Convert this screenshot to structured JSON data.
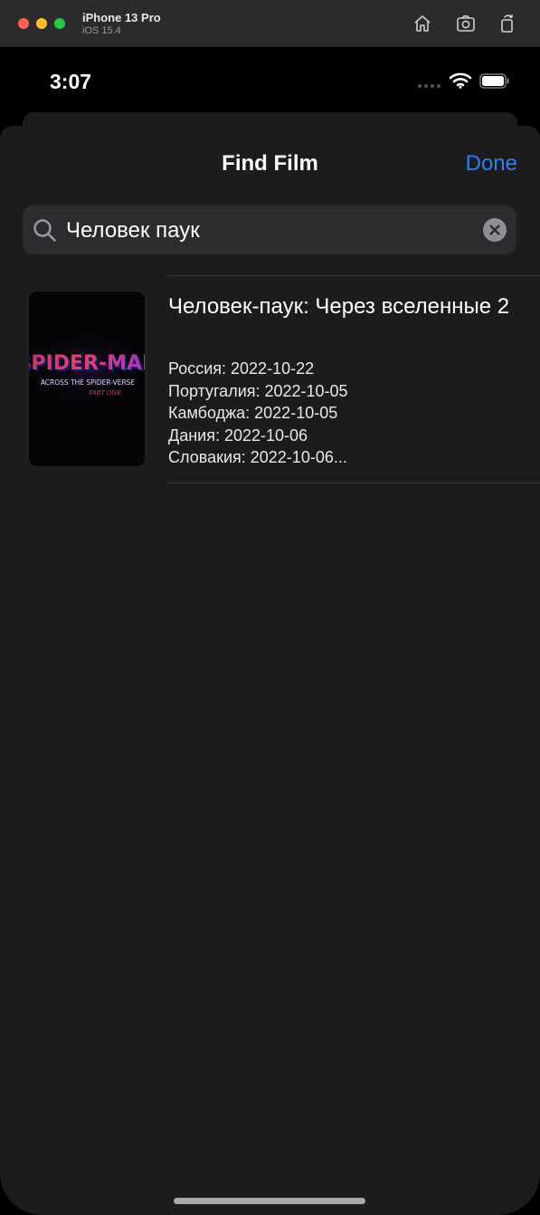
{
  "simulator": {
    "device_name": "iPhone 13 Pro",
    "os_version": "iOS 15.4",
    "toolbar_icons": [
      "home-icon",
      "screenshot-icon",
      "rotate-icon"
    ]
  },
  "status_bar": {
    "time": "3:07"
  },
  "sheet": {
    "title": "Find Film",
    "done_label": "Done",
    "accent_color": "#2f80ed"
  },
  "search": {
    "value": "Человек паук"
  },
  "results": [
    {
      "title": "Человек-паук: Через вселенные 2",
      "poster_text": "SPIDER-MAN",
      "poster_subtitle": "ACROSS THE SPIDER-VERSE",
      "poster_part": "PART ONE",
      "releases": [
        "Россия: 2022-10-22",
        "Португалия: 2022-10-05",
        "Камбоджа: 2022-10-05",
        "Дания: 2022-10-06",
        "Словакия: 2022-10-06..."
      ]
    }
  ]
}
